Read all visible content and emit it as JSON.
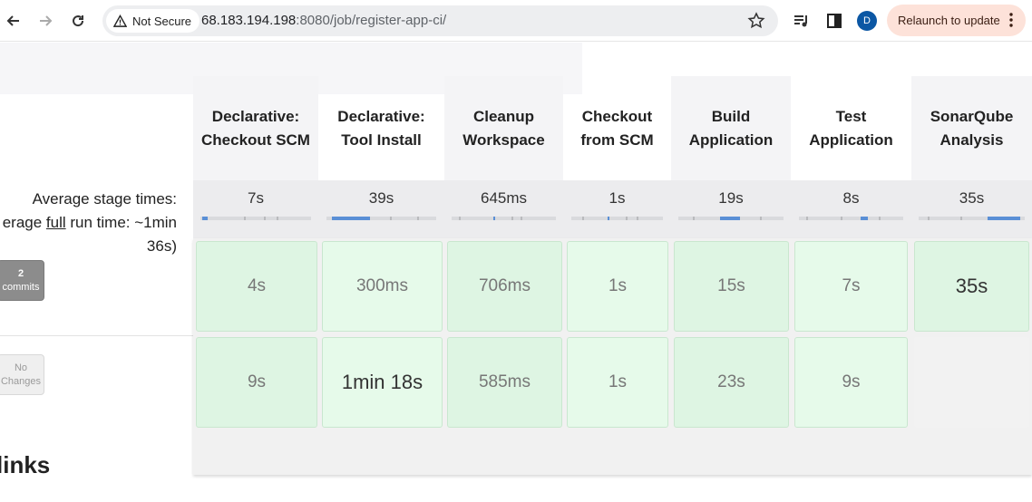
{
  "browser": {
    "security_chip": "Not Secure",
    "url_host": "68.183.194.198",
    "url_rest": ":8080/job/register-app-ci/",
    "profile_initial": "D",
    "relaunch_label": "Relaunch to update"
  },
  "stage_view": {
    "average_label": "Average stage times:",
    "full_run_prefix": "erage ",
    "full_run_word": "full",
    "full_run_suffix": " run time: ~1min",
    "full_run_tail": "36s)",
    "stages": [
      {
        "name": "Declarative: Checkout SCM",
        "avg": "7s"
      },
      {
        "name": "Declarative: Tool Install",
        "avg": "39s"
      },
      {
        "name": "Cleanup Workspace",
        "avg": "645ms"
      },
      {
        "name": "Checkout from SCM",
        "avg": "1s"
      },
      {
        "name": "Build Application",
        "avg": "19s"
      },
      {
        "name": "Test Application",
        "avg": "8s"
      },
      {
        "name": "SonarQube Analysis",
        "avg": "35s"
      }
    ],
    "runs": [
      {
        "badge_top": "2",
        "badge_bottom": "commits",
        "times": [
          "4s",
          "300ms",
          "706ms",
          "1s",
          "15s",
          "7s",
          "35s"
        ]
      },
      {
        "badge_top": "No",
        "badge_bottom": "Changes",
        "times": [
          "9s",
          "1min 18s",
          "585ms",
          "1s",
          "23s",
          "9s",
          ""
        ]
      }
    ]
  },
  "section_heading": "links"
}
